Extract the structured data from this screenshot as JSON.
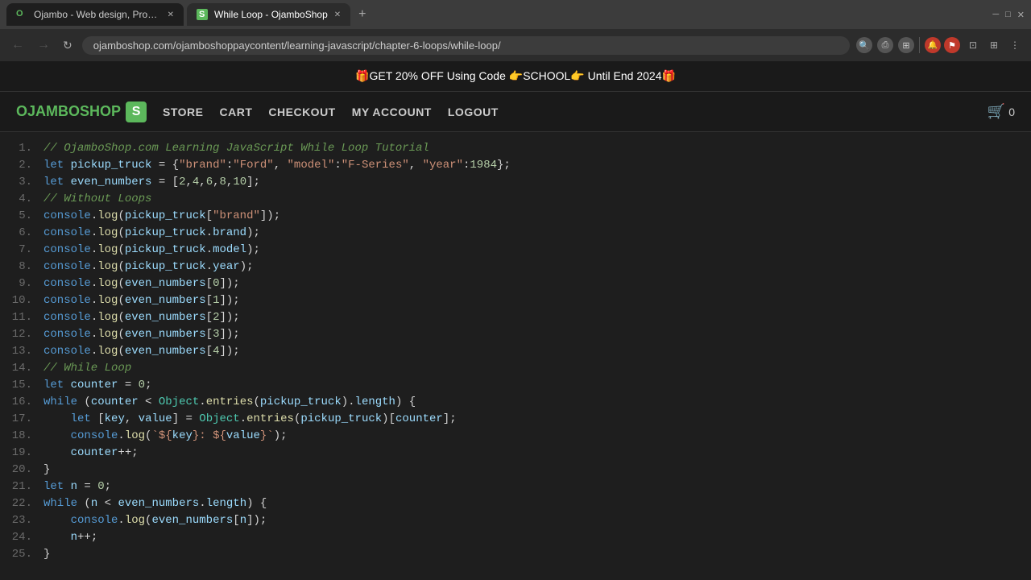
{
  "browser": {
    "tabs": [
      {
        "id": "tab-1",
        "title": "Ojambo - Web design, Progra...",
        "favicon": "O",
        "active": false
      },
      {
        "id": "tab-2",
        "title": "While Loop - OjamboShop",
        "favicon": "S",
        "active": true
      }
    ],
    "new_tab_label": "+",
    "url": "ojamboshop.com/ojamboshoppaycontent/learning-javascript/chapter-6-loops/while-loop/",
    "nav": {
      "back": "←",
      "forward": "→",
      "reload": "↻"
    },
    "window_controls": {
      "minimize": "─",
      "maximize": "□",
      "close": "✕"
    }
  },
  "promo_bar": {
    "text": "🎁GET 20% OFF Using Code 👉SCHOOL👉 Until End 2024🎁"
  },
  "nav": {
    "logo_text": "OJAMBOSHOP",
    "logo_letter": "S",
    "links": [
      {
        "label": "STORE",
        "name": "store-link"
      },
      {
        "label": "CART",
        "name": "cart-link"
      },
      {
        "label": "CHECKOUT",
        "name": "checkout-link"
      },
      {
        "label": "MY ACCOUNT",
        "name": "my-account-link"
      },
      {
        "label": "LOGOUT",
        "name": "logout-link"
      }
    ],
    "cart_icon": "🛒",
    "cart_count": "0"
  },
  "code": {
    "lines": [
      {
        "num": "1.",
        "content": "// OjamboShop.com Learning JavaScript While Loop Tutorial"
      },
      {
        "num": "2.",
        "content": "let pickup_truck = {\"brand\":\"Ford\", \"model\":\"F-Series\", \"year\":1984};"
      },
      {
        "num": "3.",
        "content": "let even_numbers = [2,4,6,8,10];"
      },
      {
        "num": "4.",
        "content": "// Without Loops"
      },
      {
        "num": "5.",
        "content": "console.log(pickup_truck[\"brand\"]);"
      },
      {
        "num": "6.",
        "content": "console.log(pickup_truck.brand);"
      },
      {
        "num": "7.",
        "content": "console.log(pickup_truck.model);"
      },
      {
        "num": "8.",
        "content": "console.log(pickup_truck.year);"
      },
      {
        "num": "9.",
        "content": "console.log(even_numbers[0]);"
      },
      {
        "num": "10.",
        "content": "console.log(even_numbers[1]);"
      },
      {
        "num": "11.",
        "content": "console.log(even_numbers[2]);"
      },
      {
        "num": "12.",
        "content": "console.log(even_numbers[3]);"
      },
      {
        "num": "13.",
        "content": "console.log(even_numbers[4]);"
      },
      {
        "num": "14.",
        "content": "// While Loop"
      },
      {
        "num": "15.",
        "content": "let counter = 0;"
      },
      {
        "num": "16.",
        "content": "while (counter < Object.entries(pickup_truck).length) {"
      },
      {
        "num": "17.",
        "content": "    let [key, value] = Object.entries(pickup_truck)[counter];"
      },
      {
        "num": "18.",
        "content": "    console.log(`${key}: ${value}`);"
      },
      {
        "num": "19.",
        "content": "    counter++;"
      },
      {
        "num": "20.",
        "content": "}"
      },
      {
        "num": "21.",
        "content": "let n = 0;"
      },
      {
        "num": "22.",
        "content": "while (n < even_numbers.length) {"
      },
      {
        "num": "23.",
        "content": "    console.log(even_numbers[n]);"
      },
      {
        "num": "24.",
        "content": "    n++;"
      },
      {
        "num": "25.",
        "content": "}"
      }
    ]
  }
}
